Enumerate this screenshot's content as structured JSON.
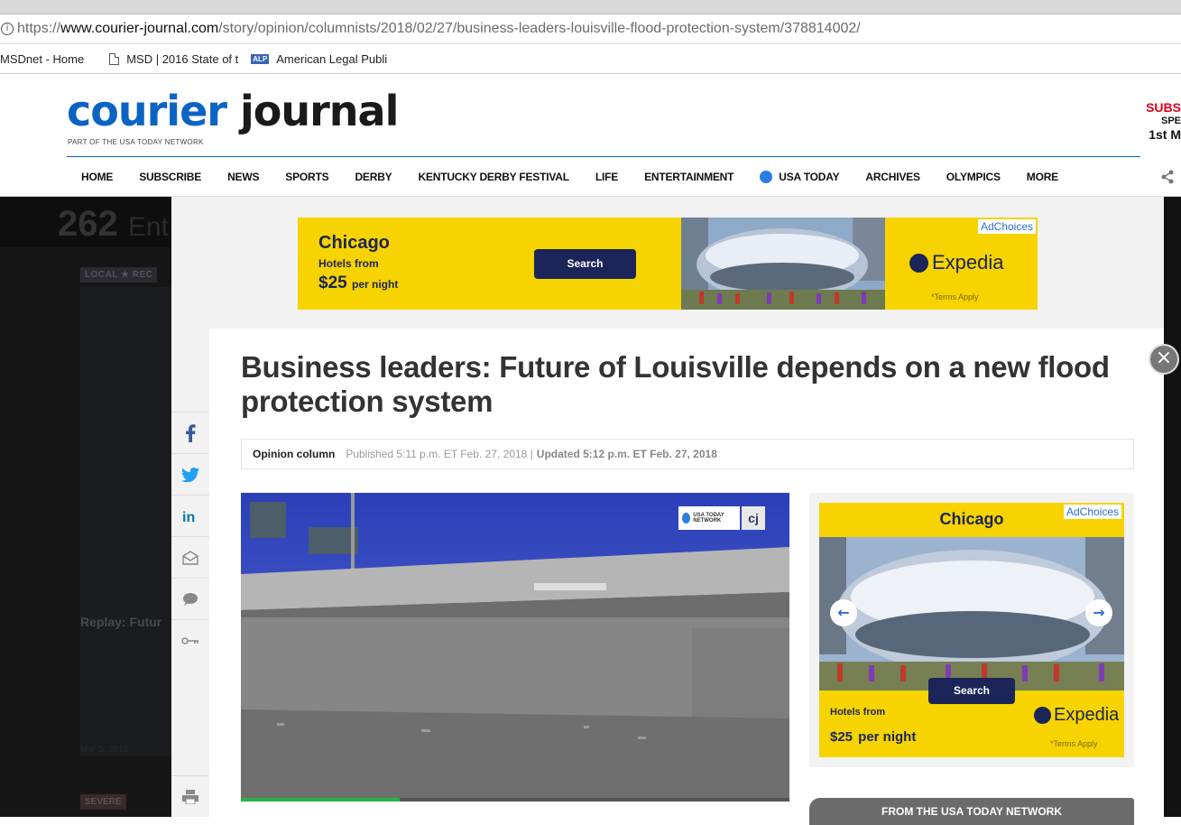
{
  "browser": {
    "url_prefix": "https://",
    "url_host": "www.courier-journal.com",
    "url_path": "/story/opinion/columnists/2018/02/27/business-leaders-louisville-flood-protection-system/378814002/",
    "bookmarks": [
      "MSDnet - Home",
      "MSD | 2016 State of t",
      "American Legal Publi"
    ],
    "alp_badge": "ALP"
  },
  "header": {
    "logo_part1": "courier",
    "logo_part2": "journal",
    "tagline": "PART OF THE USA TODAY NETWORK",
    "subscribe_line1": "SUBS",
    "subscribe_line2": "SPE",
    "subscribe_line3": "1st M"
  },
  "nav": {
    "items": [
      "HOME",
      "SUBSCRIBE",
      "NEWS",
      "SPORTS",
      "DERBY",
      "KENTUCKY DERBY FESTIVAL",
      "LIFE",
      "ENTERTAINMENT",
      "USA TODAY",
      "ARCHIVES",
      "OLYMPICS",
      "MORE"
    ]
  },
  "background": {
    "count": "262",
    "count_label": "Ent",
    "tag": "LOCAL ★ REC",
    "replay": "Replay: Futur",
    "date": "Mar 5, 2018",
    "severe": "SEVERE"
  },
  "ad_banner": {
    "city": "Chicago",
    "hotels_from": "Hotels from",
    "price": "$25",
    "per_night": "per night",
    "button": "Search",
    "adchoices": "AdChoices",
    "brand": "Expedia",
    "terms": "*Terms Apply"
  },
  "article": {
    "title": "Business leaders: Future of Louisville depends on a new flood protection system",
    "section": "Opinion column",
    "published": "Published 5:11 p.m. ET Feb. 27, 2018 |",
    "updated": "Updated 5:12 p.m. ET Feb. 27, 2018",
    "video_progress": 0.29,
    "logo_usatoday": "USA TODAY NETWORK",
    "logo_cj": "cj"
  },
  "sidebar_ad": {
    "city": "Chicago",
    "adchoices": "AdChoices",
    "button": "Search",
    "hotels_from": "Hotels from",
    "price": "$25",
    "per_night": "per night",
    "brand": "Expedia",
    "terms": "*Terms Apply"
  },
  "from_network": "FROM THE USA TODAY NETWORK",
  "close_label": "×",
  "social_icons": [
    "facebook-icon",
    "twitter-icon",
    "linkedin-icon",
    "email-icon",
    "comment-icon",
    "link-icon",
    "print-icon"
  ],
  "colors": {
    "brand_blue": "#0b63c4",
    "ad_yellow": "#f7d300",
    "ad_navy": "#1b2557",
    "progress_green": "#2ab24a"
  }
}
